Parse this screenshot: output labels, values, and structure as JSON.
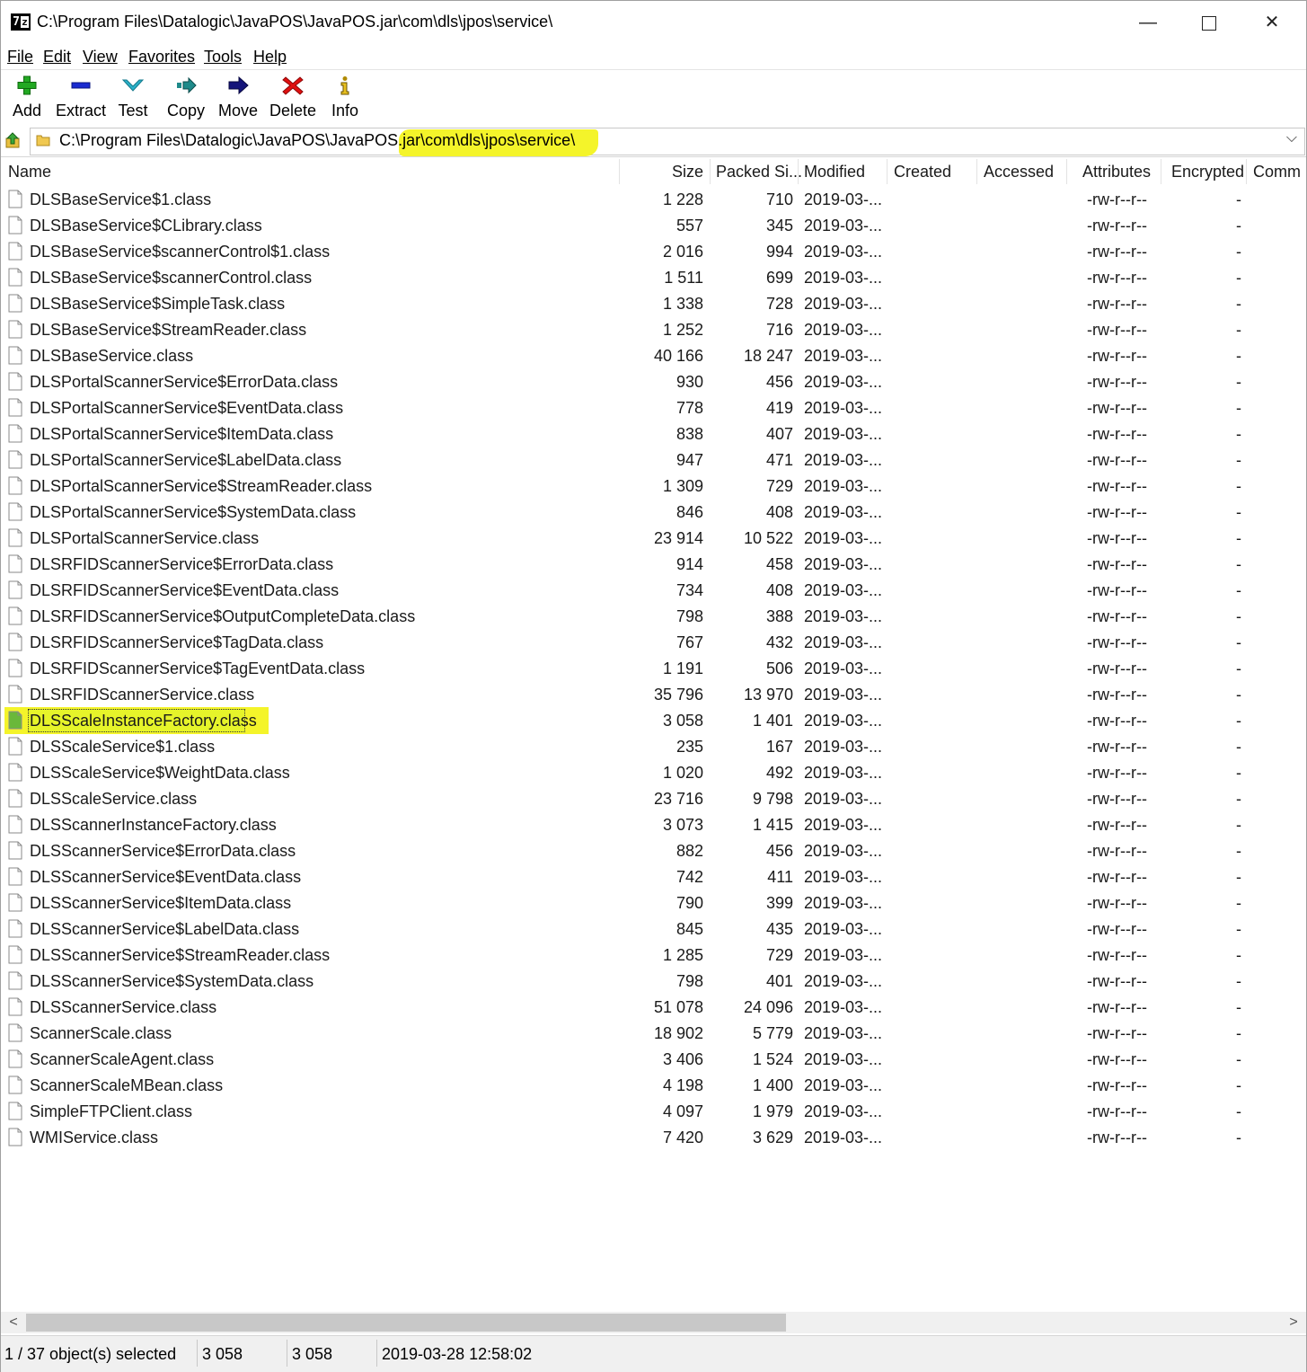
{
  "window": {
    "title": "C:\\Program Files\\Datalogic\\JavaPOS\\JavaPOS.jar\\com\\dls\\jpos\\service\\",
    "minimize": "—",
    "close": "✕"
  },
  "menu": [
    "File",
    "Edit",
    "View",
    "Favorites",
    "Tools",
    "Help"
  ],
  "toolbar": {
    "add": "Add",
    "extract": "Extract",
    "test": "Test",
    "copy": "Copy",
    "move": "Move",
    "delete": "Delete",
    "info": "Info"
  },
  "address": {
    "path": "C:\\Program Files\\Datalogic\\JavaPOS\\JavaPOS.jar\\com\\dls\\jpos\\service\\",
    "dropdown": "⌵"
  },
  "columns": {
    "name": "Name",
    "size": "Size",
    "packed": "Packed Si...",
    "modified": "Modified",
    "created": "Created",
    "accessed": "Accessed",
    "attributes": "Attributes",
    "encrypted": "Encrypted",
    "comment": "Comm"
  },
  "files": [
    {
      "name": "DLSBaseService$1.class",
      "size": "1 228",
      "packed": "710",
      "modified": "2019-03-...",
      "attributes": "-rw-r--r--",
      "encrypted": "-"
    },
    {
      "name": "DLSBaseService$CLibrary.class",
      "size": "557",
      "packed": "345",
      "modified": "2019-03-...",
      "attributes": "-rw-r--r--",
      "encrypted": "-"
    },
    {
      "name": "DLSBaseService$scannerControl$1.class",
      "size": "2 016",
      "packed": "994",
      "modified": "2019-03-...",
      "attributes": "-rw-r--r--",
      "encrypted": "-"
    },
    {
      "name": "DLSBaseService$scannerControl.class",
      "size": "1 511",
      "packed": "699",
      "modified": "2019-03-...",
      "attributes": "-rw-r--r--",
      "encrypted": "-"
    },
    {
      "name": "DLSBaseService$SimpleTask.class",
      "size": "1 338",
      "packed": "728",
      "modified": "2019-03-...",
      "attributes": "-rw-r--r--",
      "encrypted": "-"
    },
    {
      "name": "DLSBaseService$StreamReader.class",
      "size": "1 252",
      "packed": "716",
      "modified": "2019-03-...",
      "attributes": "-rw-r--r--",
      "encrypted": "-"
    },
    {
      "name": "DLSBaseService.class",
      "size": "40 166",
      "packed": "18 247",
      "modified": "2019-03-...",
      "attributes": "-rw-r--r--",
      "encrypted": "-"
    },
    {
      "name": "DLSPortalScannerService$ErrorData.class",
      "size": "930",
      "packed": "456",
      "modified": "2019-03-...",
      "attributes": "-rw-r--r--",
      "encrypted": "-"
    },
    {
      "name": "DLSPortalScannerService$EventData.class",
      "size": "778",
      "packed": "419",
      "modified": "2019-03-...",
      "attributes": "-rw-r--r--",
      "encrypted": "-"
    },
    {
      "name": "DLSPortalScannerService$ItemData.class",
      "size": "838",
      "packed": "407",
      "modified": "2019-03-...",
      "attributes": "-rw-r--r--",
      "encrypted": "-"
    },
    {
      "name": "DLSPortalScannerService$LabelData.class",
      "size": "947",
      "packed": "471",
      "modified": "2019-03-...",
      "attributes": "-rw-r--r--",
      "encrypted": "-"
    },
    {
      "name": "DLSPortalScannerService$StreamReader.class",
      "size": "1 309",
      "packed": "729",
      "modified": "2019-03-...",
      "attributes": "-rw-r--r--",
      "encrypted": "-"
    },
    {
      "name": "DLSPortalScannerService$SystemData.class",
      "size": "846",
      "packed": "408",
      "modified": "2019-03-...",
      "attributes": "-rw-r--r--",
      "encrypted": "-"
    },
    {
      "name": "DLSPortalScannerService.class",
      "size": "23 914",
      "packed": "10 522",
      "modified": "2019-03-...",
      "attributes": "-rw-r--r--",
      "encrypted": "-"
    },
    {
      "name": "DLSRFIDScannerService$ErrorData.class",
      "size": "914",
      "packed": "458",
      "modified": "2019-03-...",
      "attributes": "-rw-r--r--",
      "encrypted": "-"
    },
    {
      "name": "DLSRFIDScannerService$EventData.class",
      "size": "734",
      "packed": "408",
      "modified": "2019-03-...",
      "attributes": "-rw-r--r--",
      "encrypted": "-"
    },
    {
      "name": "DLSRFIDScannerService$OutputCompleteData.class",
      "size": "798",
      "packed": "388",
      "modified": "2019-03-...",
      "attributes": "-rw-r--r--",
      "encrypted": "-"
    },
    {
      "name": "DLSRFIDScannerService$TagData.class",
      "size": "767",
      "packed": "432",
      "modified": "2019-03-...",
      "attributes": "-rw-r--r--",
      "encrypted": "-"
    },
    {
      "name": "DLSRFIDScannerService$TagEventData.class",
      "size": "1 191",
      "packed": "506",
      "modified": "2019-03-...",
      "attributes": "-rw-r--r--",
      "encrypted": "-"
    },
    {
      "name": "DLSRFIDScannerService.class",
      "size": "35 796",
      "packed": "13 970",
      "modified": "2019-03-...",
      "attributes": "-rw-r--r--",
      "encrypted": "-"
    },
    {
      "name": "DLSScaleInstanceFactory.class",
      "size": "3 058",
      "packed": "1 401",
      "modified": "2019-03-...",
      "attributes": "-rw-r--r--",
      "encrypted": "-",
      "selected": true
    },
    {
      "name": "DLSScaleService$1.class",
      "size": "235",
      "packed": "167",
      "modified": "2019-03-...",
      "attributes": "-rw-r--r--",
      "encrypted": "-"
    },
    {
      "name": "DLSScaleService$WeightData.class",
      "size": "1 020",
      "packed": "492",
      "modified": "2019-03-...",
      "attributes": "-rw-r--r--",
      "encrypted": "-"
    },
    {
      "name": "DLSScaleService.class",
      "size": "23 716",
      "packed": "9 798",
      "modified": "2019-03-...",
      "attributes": "-rw-r--r--",
      "encrypted": "-"
    },
    {
      "name": "DLSScannerInstanceFactory.class",
      "size": "3 073",
      "packed": "1 415",
      "modified": "2019-03-...",
      "attributes": "-rw-r--r--",
      "encrypted": "-"
    },
    {
      "name": "DLSScannerService$ErrorData.class",
      "size": "882",
      "packed": "456",
      "modified": "2019-03-...",
      "attributes": "-rw-r--r--",
      "encrypted": "-"
    },
    {
      "name": "DLSScannerService$EventData.class",
      "size": "742",
      "packed": "411",
      "modified": "2019-03-...",
      "attributes": "-rw-r--r--",
      "encrypted": "-"
    },
    {
      "name": "DLSScannerService$ItemData.class",
      "size": "790",
      "packed": "399",
      "modified": "2019-03-...",
      "attributes": "-rw-r--r--",
      "encrypted": "-"
    },
    {
      "name": "DLSScannerService$LabelData.class",
      "size": "845",
      "packed": "435",
      "modified": "2019-03-...",
      "attributes": "-rw-r--r--",
      "encrypted": "-"
    },
    {
      "name": "DLSScannerService$StreamReader.class",
      "size": "1 285",
      "packed": "729",
      "modified": "2019-03-...",
      "attributes": "-rw-r--r--",
      "encrypted": "-"
    },
    {
      "name": "DLSScannerService$SystemData.class",
      "size": "798",
      "packed": "401",
      "modified": "2019-03-...",
      "attributes": "-rw-r--r--",
      "encrypted": "-"
    },
    {
      "name": "DLSScannerService.class",
      "size": "51 078",
      "packed": "24 096",
      "modified": "2019-03-...",
      "attributes": "-rw-r--r--",
      "encrypted": "-"
    },
    {
      "name": "ScannerScale.class",
      "size": "18 902",
      "packed": "5 779",
      "modified": "2019-03-...",
      "attributes": "-rw-r--r--",
      "encrypted": "-"
    },
    {
      "name": "ScannerScaleAgent.class",
      "size": "3 406",
      "packed": "1 524",
      "modified": "2019-03-...",
      "attributes": "-rw-r--r--",
      "encrypted": "-"
    },
    {
      "name": "ScannerScaleMBean.class",
      "size": "4 198",
      "packed": "1 400",
      "modified": "2019-03-...",
      "attributes": "-rw-r--r--",
      "encrypted": "-"
    },
    {
      "name": "SimpleFTPClient.class",
      "size": "4 097",
      "packed": "1 979",
      "modified": "2019-03-...",
      "attributes": "-rw-r--r--",
      "encrypted": "-"
    },
    {
      "name": "WMIService.class",
      "size": "7 420",
      "packed": "3 629",
      "modified": "2019-03-...",
      "attributes": "-rw-r--r--",
      "encrypted": "-"
    }
  ],
  "status": {
    "selection": "1 / 37 object(s) selected",
    "size": "3 058",
    "packed": "3 058",
    "modified": "2019-03-28 12:58:02"
  },
  "scroll": {
    "left": "<",
    "right": ">"
  },
  "colors": {
    "highlight": "#f4f42a",
    "add_icon": "#22a822",
    "extract_icon": "#1a2bd0",
    "test_icon": "#2ab0c8",
    "copy_icon": "#1e8a8a",
    "move_icon": "#14147a",
    "delete_icon": "#e01010",
    "info_icon": "#b08a00"
  }
}
